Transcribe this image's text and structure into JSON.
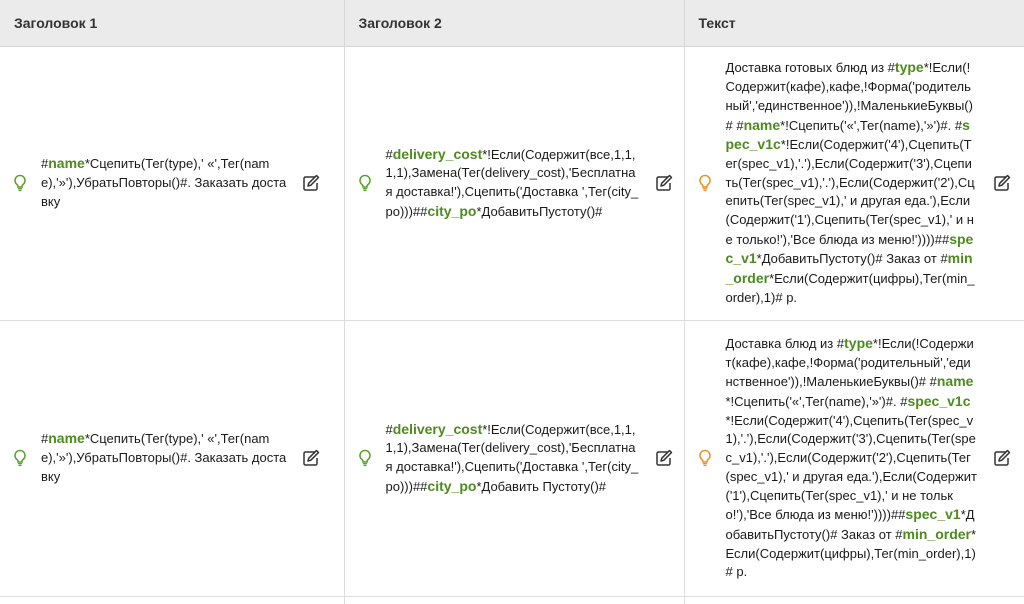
{
  "table": {
    "headers": [
      "Заголовок 1",
      "Заголовок 2",
      "Текст"
    ],
    "rows": [
      {
        "title1": [
          {
            "t": "#"
          },
          {
            "t": "name",
            "tag": true
          },
          {
            "t": "*Сцепить(Тег(type),' «',Тег(name),'»'),УбратьПовторы()#. Заказать доставку"
          }
        ],
        "title2": [
          {
            "t": "#"
          },
          {
            "t": "delivery_cost",
            "tag": true
          },
          {
            "t": "*!Если(Содержит(все,1,1,1,1),Замена(Тег(delivery_cost),'Бесплатная доставка!'),Сцепить('Доставка ',Тег(city_po)))##"
          },
          {
            "t": "city_po",
            "tag": true
          },
          {
            "t": "*ДобавитьПустоту()#"
          }
        ],
        "text": [
          {
            "t": "Доставка готовых блюд из #"
          },
          {
            "t": "type",
            "tag": true
          },
          {
            "t": "*!Если(!Содержит(кафе),кафе,!Форма('родительный','единственное')),!МаленькиеБуквы()# #"
          },
          {
            "t": "name",
            "tag": true
          },
          {
            "t": "*!Сцепить('«',Тег(name),'»')#. #"
          },
          {
            "t": "spec_v1c",
            "tag": true
          },
          {
            "t": "*!Если(Содержит('4'),Сцепить(Тег(spec_v1),'.'),Если(Содержит('3'),Сцепить(Тег(spec_v1),'.'),Если(Содержит('2'),Сцепить(Тег(spec_v1),' и другая еда.'),Если(Содержит('1'),Сцепить(Тег(spec_v1),' и не только!'),'Все блюда из меню!'))))##"
          },
          {
            "t": "spec_v1",
            "tag": true
          },
          {
            "t": "*ДобавитьПустоту()# Заказ от #"
          },
          {
            "t": "min_order",
            "tag": true
          },
          {
            "t": "*Если(Содержит(цифры),Тег(min_order),1)# р."
          }
        ]
      },
      {
        "title1": [
          {
            "t": "#"
          },
          {
            "t": "name",
            "tag": true
          },
          {
            "t": "*Сцепить(Тег(type),' «',Тег(name),'»'),УбратьПовторы()#. Заказать доставку"
          }
        ],
        "title2": [
          {
            "t": "#"
          },
          {
            "t": "delivery_cost",
            "tag": true
          },
          {
            "t": "*!Если(Содержит(все,1,1,1,1),Замена(Тег(delivery_cost),'Бесплатная доставка!'),Сцепить('Доставка ',Тег(city_po)))##"
          },
          {
            "t": "city_po",
            "tag": true
          },
          {
            "t": "*Добавить Пустоту()#"
          }
        ],
        "text": [
          {
            "t": "Доставка блюд из #"
          },
          {
            "t": "type",
            "tag": true
          },
          {
            "t": "*!Если(!Содержит(кафе),кафе,!Форма('родительный','единственное')),!МаленькиеБуквы()# #"
          },
          {
            "t": "name",
            "tag": true
          },
          {
            "t": "*!Сцепить('«',Тег(name),'»')#. #"
          },
          {
            "t": "spec_v1c",
            "tag": true
          },
          {
            "t": "*!Если(Содержит('4'),Сцепить(Тег(spec_v1),'.'),Если(Содержит('3'),Сцепить(Тег(spec_v1),'.'),Если(Содержит('2'),Сцепить(Тег(spec_v1),' и другая еда.'),Если(Содержит('1'),Сцепить(Тег(spec_v1),' и не только!'),'Все блюда из меню!'))))##"
          },
          {
            "t": "spec_v1",
            "tag": true
          },
          {
            "t": "*ДобавитьПустоту()# Заказ от #"
          },
          {
            "t": "min_order",
            "tag": true
          },
          {
            "t": "*Если(Содержит(цифры),Тег(min_order),1)# р."
          }
        ]
      }
    ]
  },
  "icons": {
    "bulb_green": "lightbulb-icon",
    "bulb_orange": "lightbulb-icon",
    "edit": "edit-pencil-icon"
  },
  "colors": {
    "tag": "#4d8b1f",
    "bulb_ok": "#5aa02c",
    "bulb_warn": "#e8912a",
    "header_bg": "#ebebeb"
  }
}
